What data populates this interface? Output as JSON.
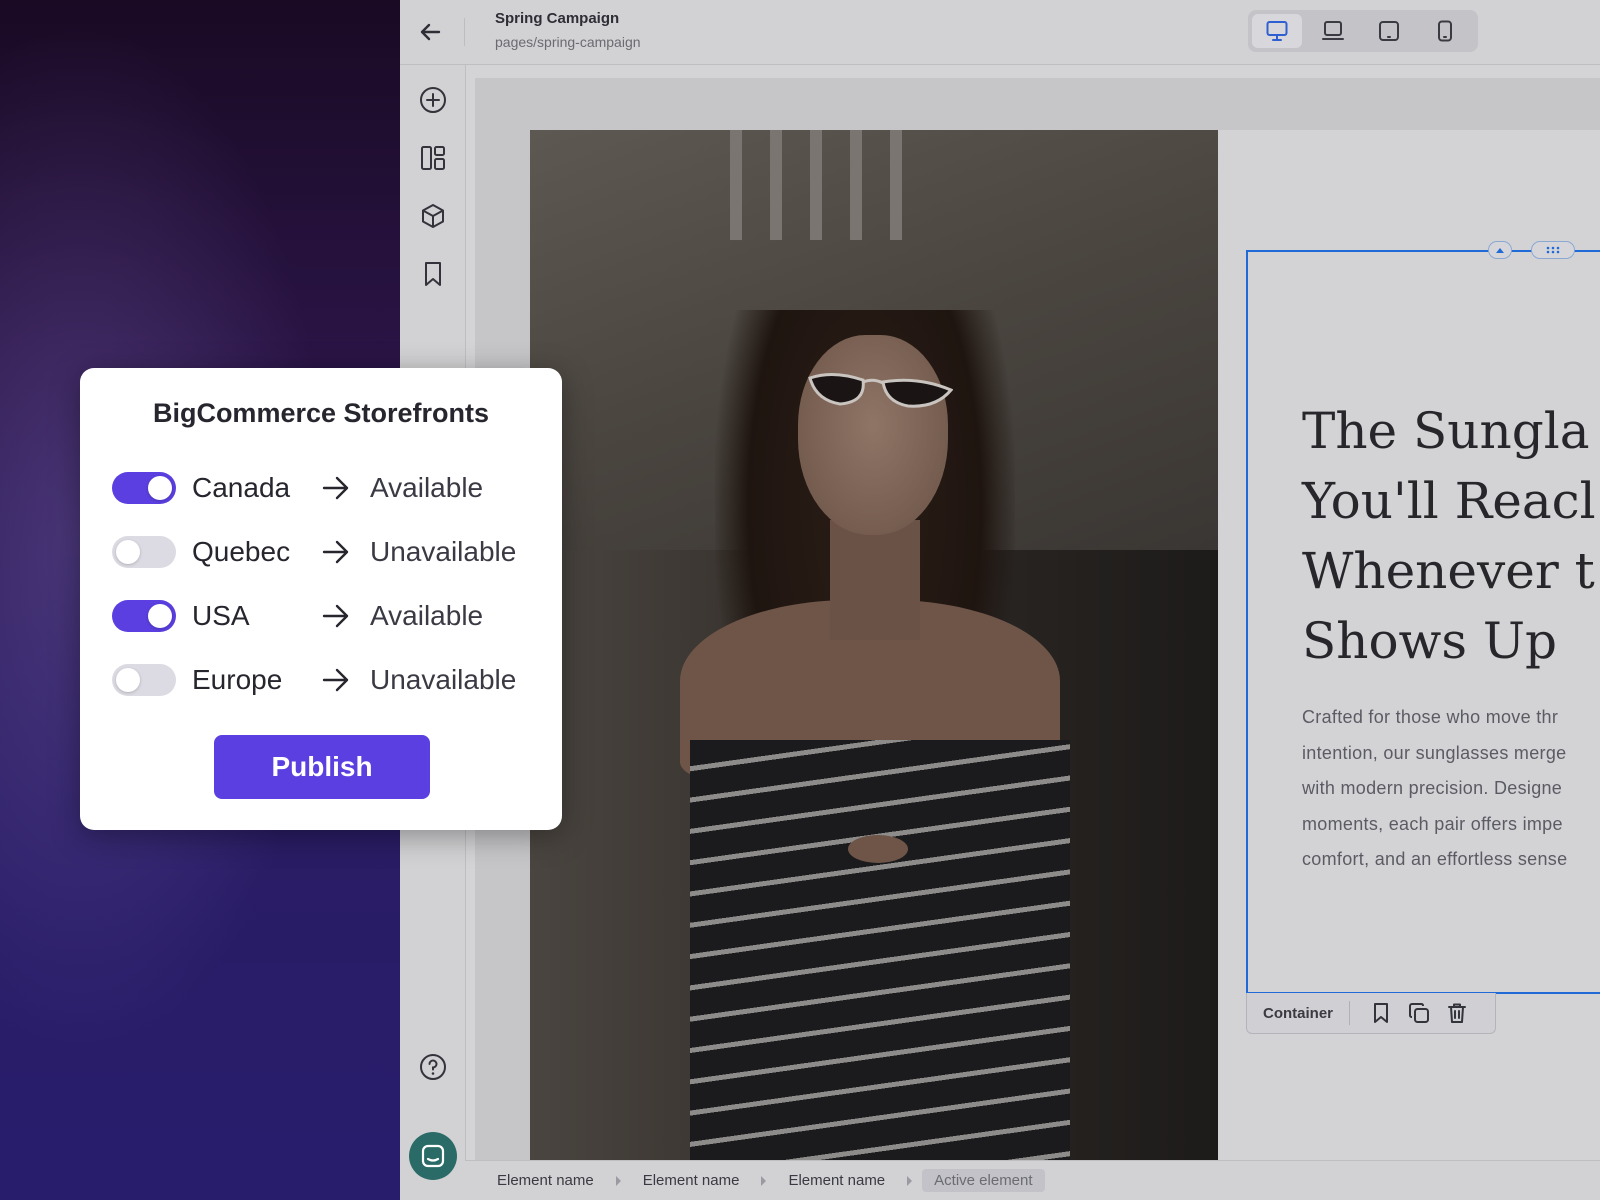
{
  "header": {
    "title": "Spring Campaign",
    "path": "pages/spring-campaign",
    "devices": [
      {
        "icon": "desktop-icon",
        "active": true
      },
      {
        "icon": "laptop-icon",
        "active": false
      },
      {
        "icon": "tablet-icon",
        "active": false
      },
      {
        "icon": "mobile-icon",
        "active": false
      }
    ]
  },
  "sidebar": {
    "items": [
      {
        "icon": "add-circle-icon"
      },
      {
        "icon": "layout-icon"
      },
      {
        "icon": "cube-icon"
      },
      {
        "icon": "bookmark-icon"
      }
    ],
    "help_icon": "help-icon",
    "chat_icon": "chat-icon"
  },
  "canvas": {
    "heading_lines": [
      "The Sungla",
      "You'll Reacl",
      "Whenever t",
      "Shows Up"
    ],
    "body_lines": [
      "Crafted for those who move thr",
      "intention, our sunglasses merge",
      "with modern precision. Designe",
      "moments, each pair offers impe",
      "comfort, and an effortless sense"
    ],
    "selection_label": "Container"
  },
  "breadcrumb": {
    "items": [
      "Element name",
      "Element name",
      "Element name"
    ],
    "active": "Active element"
  },
  "modal": {
    "title": "BigCommerce Storefronts",
    "rows": [
      {
        "region": "Canada",
        "enabled": true,
        "status": "Available"
      },
      {
        "region": "Quebec",
        "enabled": false,
        "status": "Unavailable"
      },
      {
        "region": "USA",
        "enabled": true,
        "status": "Available"
      },
      {
        "region": "Europe",
        "enabled": false,
        "status": "Unavailable"
      }
    ],
    "publish_label": "Publish"
  },
  "colors": {
    "accent": "#5b3fe0",
    "selection": "#1f6ad6",
    "chat": "#2b6b67"
  }
}
